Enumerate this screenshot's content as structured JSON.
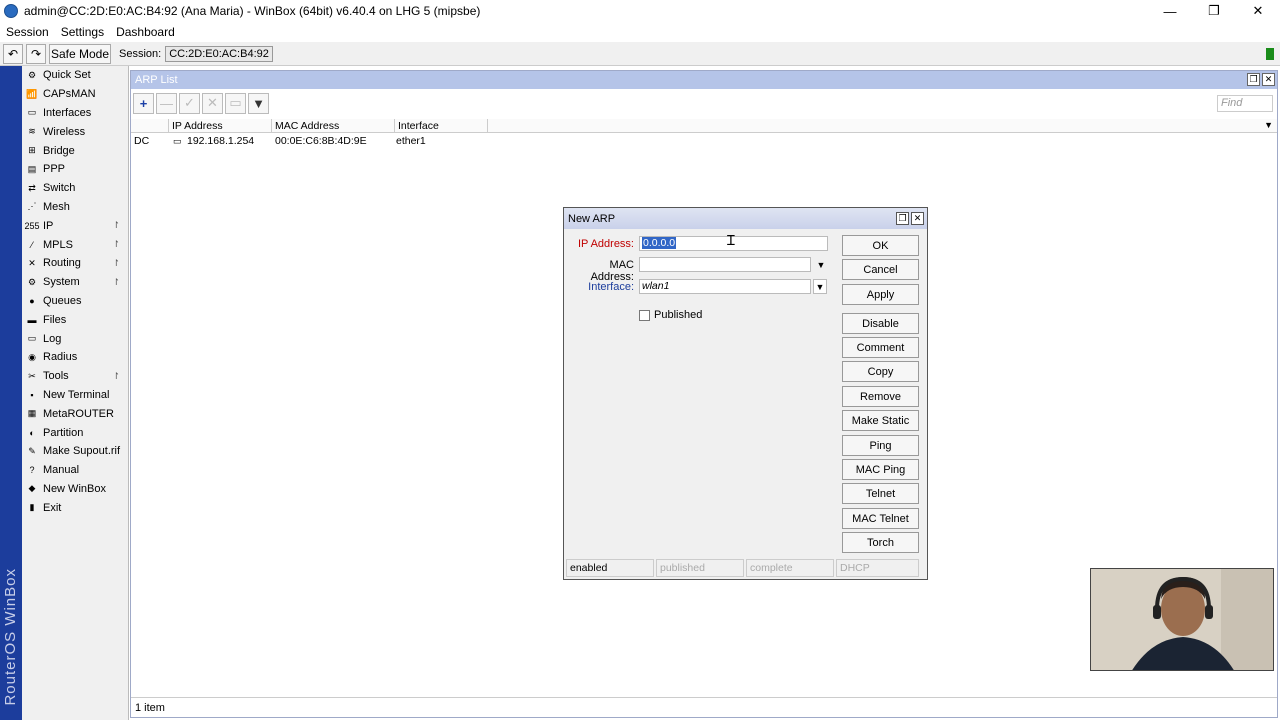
{
  "window": {
    "title": "admin@CC:2D:E0:AC:B4:92 (Ana Maria) - WinBox (64bit) v6.40.4 on LHG 5 (mipsbe)",
    "minimize": "—",
    "restore": "❐",
    "close": "✕"
  },
  "menu": [
    "Session",
    "Settings",
    "Dashboard"
  ],
  "toolbar": {
    "undo": "↶",
    "redo": "↷",
    "safe_mode": "Safe Mode",
    "session_label": "Session:",
    "session_value": "CC:2D:E0:AC:B4:92"
  },
  "brand": "RouterOS WinBox",
  "sidebar": [
    {
      "label": "Quick Set",
      "icon": "quick-set-icon",
      "glyph": "⚙"
    },
    {
      "label": "CAPsMAN",
      "icon": "capsman-icon",
      "glyph": "📶"
    },
    {
      "label": "Interfaces",
      "icon": "interfaces-icon",
      "glyph": "▭"
    },
    {
      "label": "Wireless",
      "icon": "wireless-icon",
      "glyph": "≋"
    },
    {
      "label": "Bridge",
      "icon": "bridge-icon",
      "glyph": "⊞"
    },
    {
      "label": "PPP",
      "icon": "ppp-icon",
      "glyph": "▤"
    },
    {
      "label": "Switch",
      "icon": "switch-icon",
      "glyph": "⇄"
    },
    {
      "label": "Mesh",
      "icon": "mesh-icon",
      "glyph": "⋰"
    },
    {
      "label": "IP",
      "icon": "ip-icon",
      "glyph": "255",
      "arrow": "↾"
    },
    {
      "label": "MPLS",
      "icon": "mpls-icon",
      "glyph": "⁄",
      "arrow": "↾"
    },
    {
      "label": "Routing",
      "icon": "routing-icon",
      "glyph": "✕",
      "arrow": "↾"
    },
    {
      "label": "System",
      "icon": "system-icon",
      "glyph": "⚙",
      "arrow": "↾"
    },
    {
      "label": "Queues",
      "icon": "queues-icon",
      "glyph": "●"
    },
    {
      "label": "Files",
      "icon": "files-icon",
      "glyph": "▬"
    },
    {
      "label": "Log",
      "icon": "log-icon",
      "glyph": "▭"
    },
    {
      "label": "Radius",
      "icon": "radius-icon",
      "glyph": "◉"
    },
    {
      "label": "Tools",
      "icon": "tools-icon",
      "glyph": "✂",
      "arrow": "↾"
    },
    {
      "label": "New Terminal",
      "icon": "terminal-icon",
      "glyph": "▪"
    },
    {
      "label": "MetaROUTER",
      "icon": "metarouter-icon",
      "glyph": "▦"
    },
    {
      "label": "Partition",
      "icon": "partition-icon",
      "glyph": "◐"
    },
    {
      "label": "Make Supout.rif",
      "icon": "supout-icon",
      "glyph": "✎"
    },
    {
      "label": "Manual",
      "icon": "manual-icon",
      "glyph": "?"
    },
    {
      "label": "New WinBox",
      "icon": "winbox-icon",
      "glyph": "◆"
    },
    {
      "label": "Exit",
      "icon": "exit-icon",
      "glyph": "▮"
    }
  ],
  "arp_list": {
    "title": "ARP List",
    "find_placeholder": "Find",
    "columns": [
      "IP Address",
      "MAC Address",
      "Interface"
    ],
    "rows": [
      {
        "flags": "DC",
        "ip": "192.168.1.254",
        "mac": "00:0E:C6:8B:4D:9E",
        "interface": "ether1"
      }
    ],
    "status": "1 item",
    "toolbar": {
      "add": "+",
      "remove": "—",
      "enable": "✓",
      "disable": "✕",
      "comment": "▭",
      "filter": "▼"
    }
  },
  "dialog": {
    "title": "New ARP",
    "ip_label": "IP Address:",
    "ip_value": "0.0.0.0",
    "mac_label": "MAC Address:",
    "mac_value": "",
    "interface_label": "Interface:",
    "interface_value": "wlan1",
    "published_label": "Published",
    "published_checked": false,
    "buttons": [
      "OK",
      "Cancel",
      "Apply",
      "Disable",
      "Comment",
      "Copy",
      "Remove",
      "Make Static",
      "Ping",
      "MAC Ping",
      "Telnet",
      "MAC Telnet",
      "Torch"
    ],
    "status": [
      "enabled",
      "published",
      "complete",
      "DHCP"
    ]
  },
  "colors": {
    "brand_blue": "#1c3d9c",
    "required_label": "#c00000",
    "selection": "#3166c7"
  }
}
